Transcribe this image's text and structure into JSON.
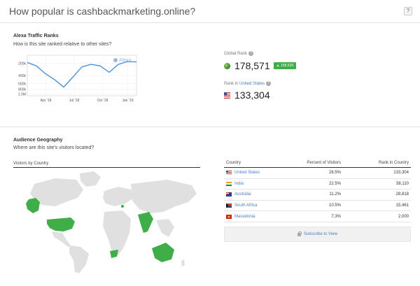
{
  "header": {
    "title": "How popular is cashbackmarketing.online?",
    "help_label": "?"
  },
  "traffic": {
    "title": "Alexa Traffic Ranks",
    "subtitle": "How is this site ranked relative to other sites?",
    "chart_watermark": "Alexa"
  },
  "chart_data": {
    "type": "line",
    "title": "",
    "x_ticks": [
      "Apr '18",
      "Jul '18",
      "Oct '18",
      "Jan '19"
    ],
    "y_ticks": [
      "200k",
      "400k",
      "600k",
      "800k",
      "1.0M"
    ],
    "y_scale": "inverted",
    "ylim": [
      1000000,
      100000
    ],
    "series": [
      {
        "x": [
          "Feb '18",
          "Mar '18",
          "Apr '18",
          "May '18",
          "Jun '18",
          "Jul '18",
          "Aug '18",
          "Sep '18",
          "Oct '18",
          "Nov '18",
          "Dec '18",
          "Jan '19",
          "Feb '19"
        ],
        "values": [
          180000,
          250000,
          410000,
          530000,
          680000,
          480000,
          270000,
          220000,
          250000,
          380000,
          220000,
          160000,
          170000
        ]
      }
    ],
    "grid": true,
    "color": "#4a90d9"
  },
  "global_rank": {
    "label": "Global Rank",
    "value": "178,571",
    "delta": "158,529",
    "delta_icon": "up-arrow",
    "icon": "globe-icon"
  },
  "country_rank": {
    "label_prefix": "Rank in",
    "country": "United States",
    "value": "133,304",
    "icon": "us-flag-icon"
  },
  "geography": {
    "title": "Audience Geography",
    "subtitle": "Where are this site's visitors located?",
    "map_label": "Visitors by Country",
    "highlight_color": "#3fae49",
    "base_color": "#e0e0e0"
  },
  "table": {
    "headers": [
      "Country",
      "Percent of Visitors",
      "Rank in Country"
    ],
    "rows": [
      {
        "country": "United States",
        "percent": "28.5%",
        "rank": "133,304",
        "flag": "us"
      },
      {
        "country": "India",
        "percent": "22.5%",
        "rank": "58,110",
        "flag": "in"
      },
      {
        "country": "Australia",
        "percent": "11.2%",
        "rank": "28,818",
        "flag": "au"
      },
      {
        "country": "South Africa",
        "percent": "10.5%",
        "rank": "15,461",
        "flag": "za"
      },
      {
        "country": "Macedonia",
        "percent": "7.3%",
        "rank": "2,000",
        "flag": "mk"
      }
    ]
  },
  "subscribe": {
    "label": "Subscribe to View"
  }
}
